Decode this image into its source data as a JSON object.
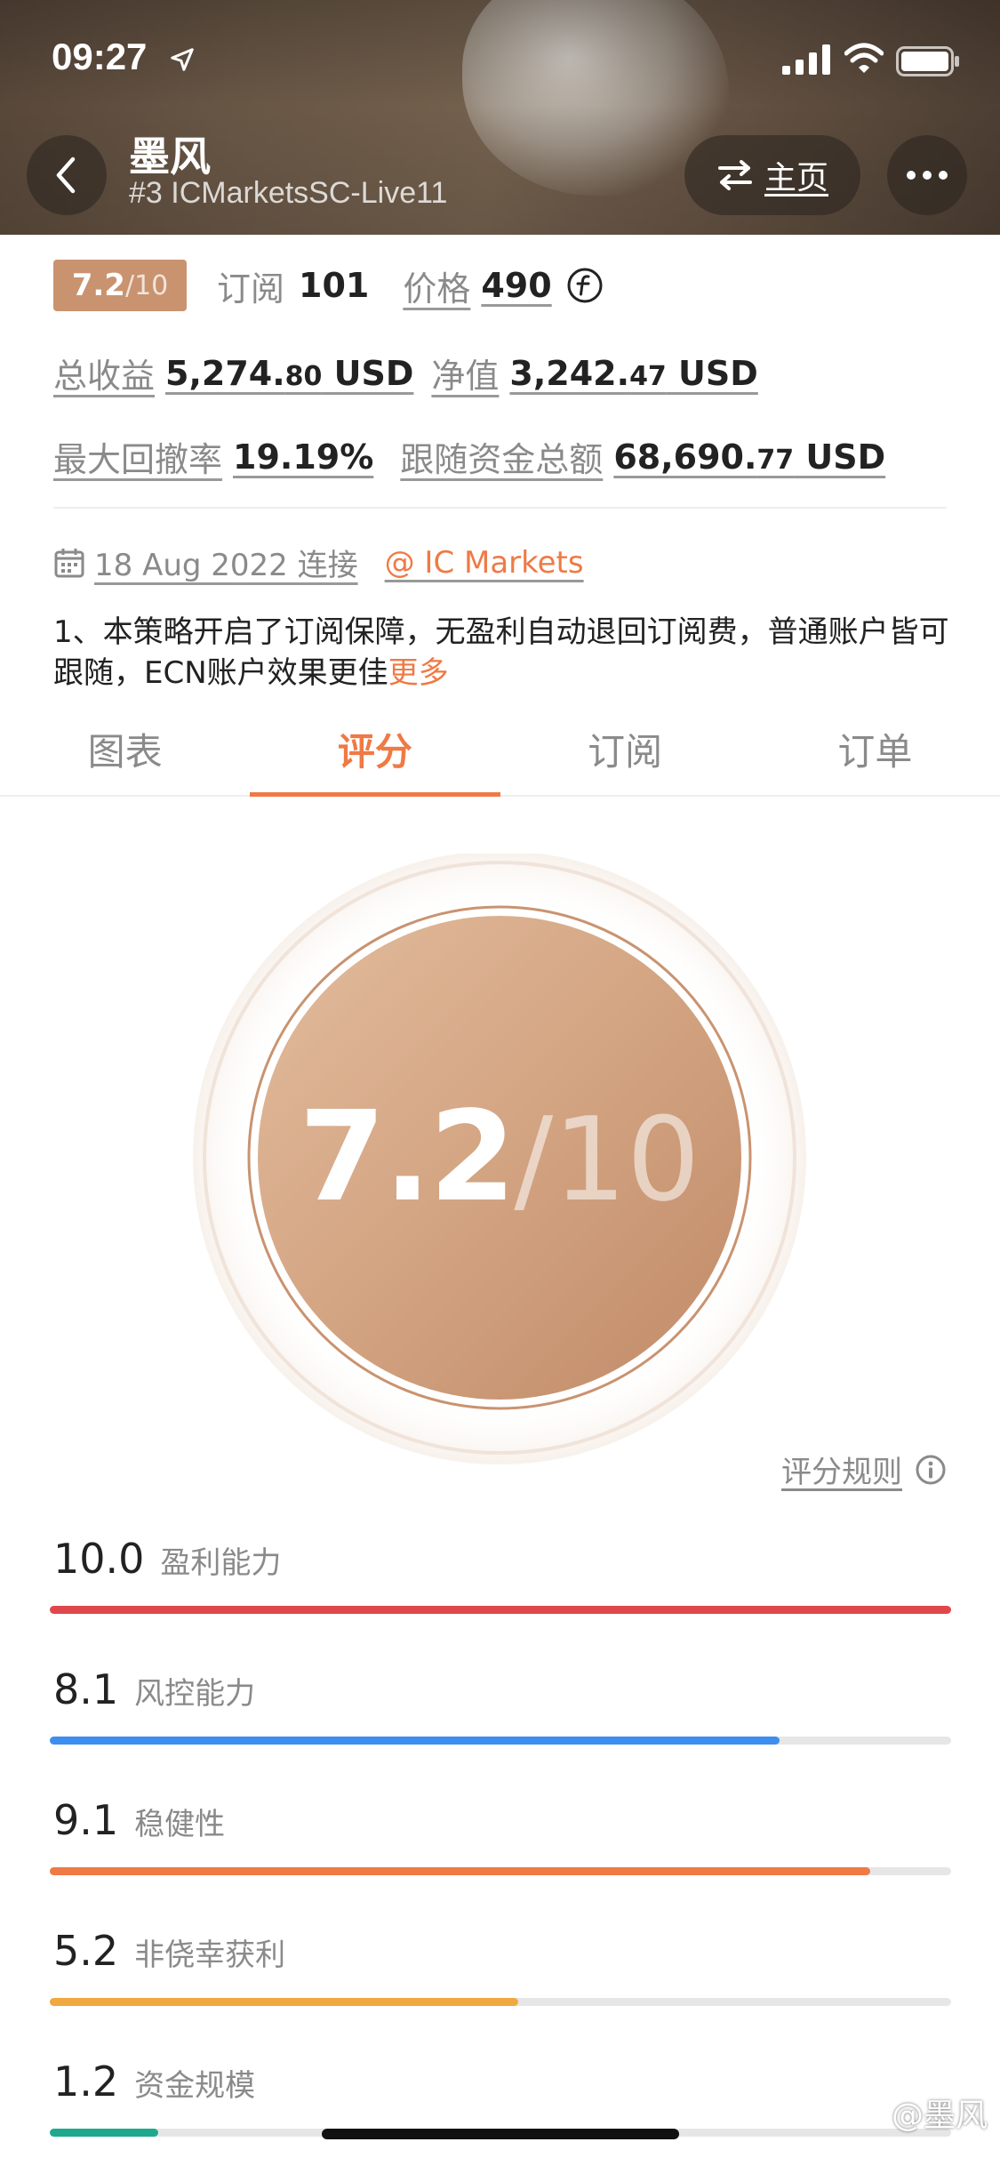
{
  "status_bar": {
    "time": "09:27"
  },
  "header": {
    "title": "墨风",
    "subtitle": "#3 ICMarketsSC-Live11",
    "home_label": "主页"
  },
  "stats": {
    "rating_value": "7.2",
    "rating_denominator": "/10",
    "subscribe_label": "订阅",
    "subscribe_count": "101",
    "price_label": "价格",
    "price_value": "490",
    "total_profit_label": "总收益",
    "total_profit_int": "5,274.",
    "total_profit_dec": "80",
    "total_profit_unit": " USD",
    "net_value_label": "净值",
    "net_value_int": "3,242.",
    "net_value_dec": "47",
    "net_value_unit": " USD",
    "max_drawdown_label": "最大回撤率",
    "max_drawdown_value": "19.19%",
    "follow_funds_label": "跟随资金总额",
    "follow_funds_int": "68,690.",
    "follow_funds_dec": "77",
    "follow_funds_unit": " USD"
  },
  "meta": {
    "connected_date": "18 Aug 2022 连接",
    "broker": "@ IC Markets"
  },
  "description": {
    "text": "1、本策略开启了订阅保障，无盈利自动退回订阅费，普通账户皆可跟随，ECN账户效果更佳",
    "more_label": "更多"
  },
  "tabs": [
    {
      "label": "图表",
      "active": false
    },
    {
      "label": "评分",
      "active": true
    },
    {
      "label": "订阅",
      "active": false
    },
    {
      "label": "订单",
      "active": false
    }
  ],
  "score": {
    "value": "7.2",
    "denominator": "/10",
    "rules_label": "评分规则"
  },
  "metrics": [
    {
      "value": "10.0",
      "name": "盈利能力",
      "fraction": 1.0,
      "color": "#e0474c"
    },
    {
      "value": "8.1",
      "name": "风控能力",
      "fraction": 0.81,
      "color": "#3e8ef0"
    },
    {
      "value": "9.1",
      "name": "稳健性",
      "fraction": 0.91,
      "color": "#ef7a45"
    },
    {
      "value": "5.2",
      "name": "非侥幸获利",
      "fraction": 0.52,
      "color": "#f0a840"
    },
    {
      "value": "1.2",
      "name": "资金规模",
      "fraction": 0.12,
      "color": "#1fa98c"
    }
  ],
  "watermark": "@墨风",
  "colors": {
    "accent": "#ef7a45",
    "badge": "#c99370"
  }
}
